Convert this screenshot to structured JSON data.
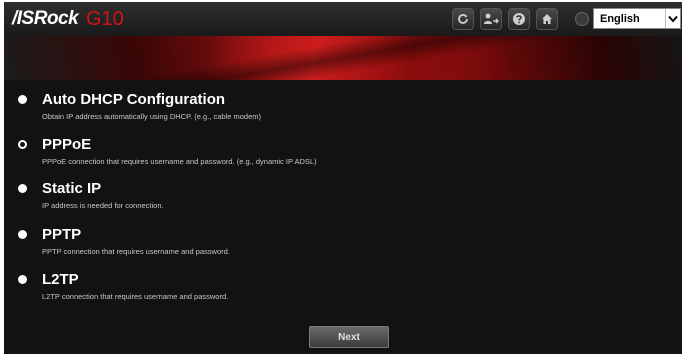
{
  "header": {
    "brand": "/ISRock",
    "model": "G10",
    "language": {
      "selected": "English"
    },
    "icons": [
      "refresh-icon",
      "user-transfer-icon",
      "help-icon",
      "home-icon",
      "globe-icon"
    ]
  },
  "options": [
    {
      "title": "Auto DHCP Configuration",
      "description": "Obtain IP address automatically using DHCP. (e.g., cable modem)",
      "selected": false
    },
    {
      "title": "PPPoE",
      "description": "PPPoE connection that requires username and password. (e.g., dynamic IP ADSL)",
      "selected": true
    },
    {
      "title": "Static IP",
      "description": "IP address is needed for connection.",
      "selected": false
    },
    {
      "title": "PPTP",
      "description": "PPTP connection that requires username and password.",
      "selected": false
    },
    {
      "title": "L2TP",
      "description": "L2TP connection that requires username and password.",
      "selected": false
    }
  ],
  "next_label": "Next",
  "colors": {
    "brand_red": "#d21414",
    "background": "#121212"
  }
}
